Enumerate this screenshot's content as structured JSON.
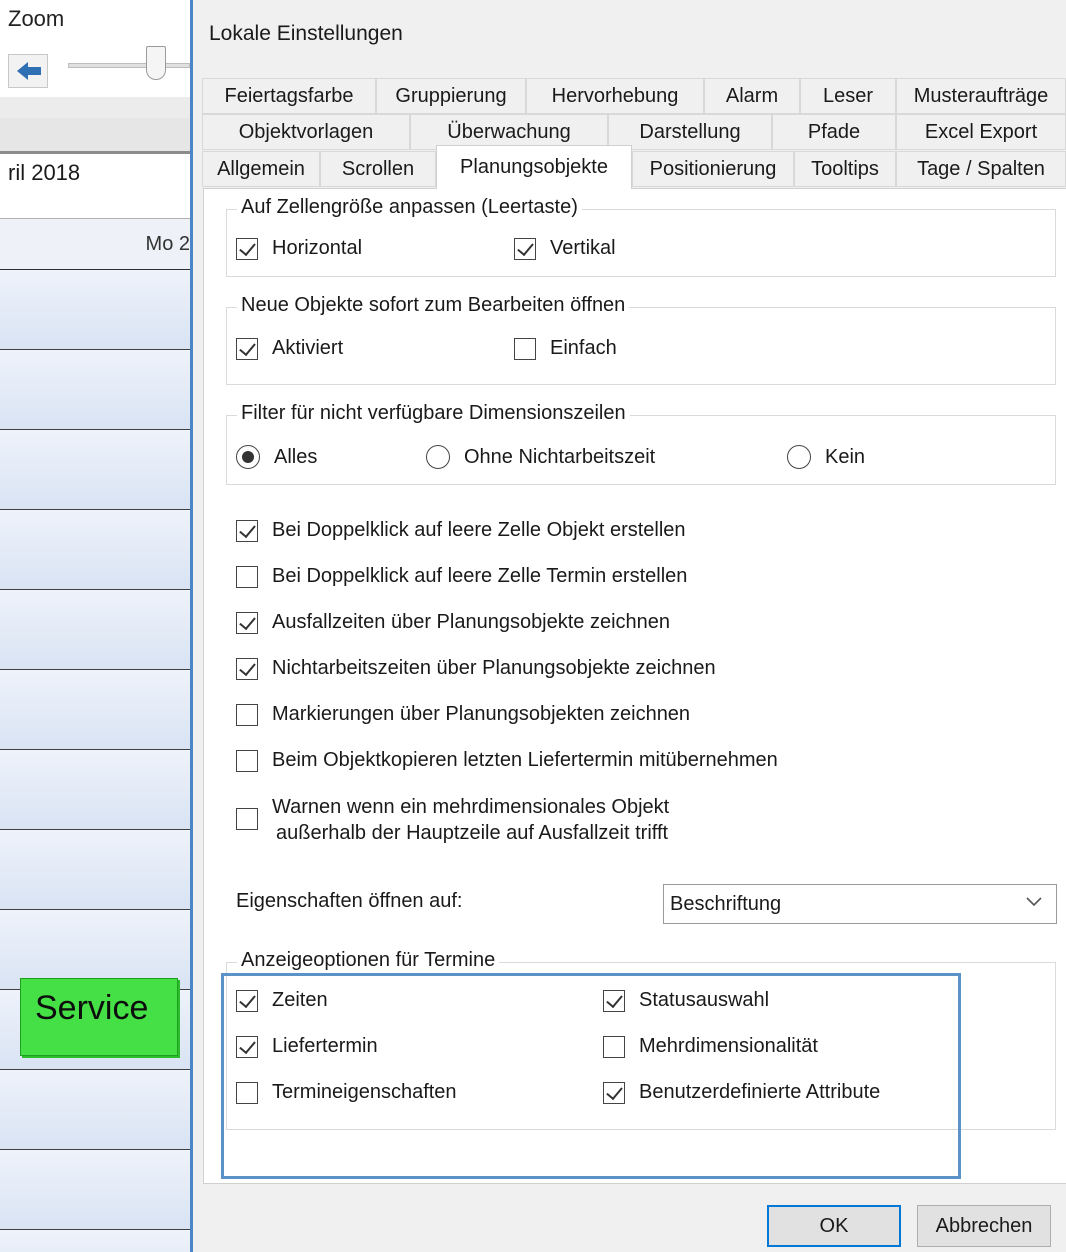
{
  "background_app": {
    "zoom_label": "Zoom",
    "month_label": "ril 2018",
    "day_label": "Mo 2",
    "service_label": "Service",
    "service_color": "#45e045"
  },
  "dialog": {
    "title": "Lokale Einstellungen",
    "tabs_row1": [
      "Feiertagsfarbe",
      "Gruppierung",
      "Hervorhebung",
      "Alarm",
      "Leser",
      "Musteraufträge"
    ],
    "tabs_row2": [
      "Objektvorlagen",
      "Überwachung",
      "Darstellung",
      "Pfade",
      "Excel Export"
    ],
    "tabs_row3": [
      "Allgemein",
      "Scrollen",
      "Planungsobjekte",
      "Positionierung",
      "Tooltips",
      "Tage / Spalten"
    ],
    "active_tab": "Planungsobjekte",
    "group_fit": {
      "title": "Auf Zellengröße anpassen (Leertaste)",
      "horizontal": "Horizontal",
      "vertical": "Vertikal"
    },
    "group_new": {
      "title": "Neue Objekte sofort zum Bearbeiten öffnen",
      "activated": "Aktiviert",
      "simple": "Einfach"
    },
    "group_filter": {
      "title": "Filter für nicht verfügbare Dimensionszeilen",
      "all": "Alles",
      "without_nonwork": "Ohne Nichtarbeitszeit",
      "none": "Kein"
    },
    "options": [
      {
        "label": "Bei Doppelklick auf leere Zelle Objekt erstellen",
        "checked": true
      },
      {
        "label": "Bei Doppelklick auf leere Zelle Termin erstellen",
        "checked": false
      },
      {
        "label": "Ausfallzeiten über Planungsobjekte zeichnen",
        "checked": true
      },
      {
        "label": "Nichtarbeitszeiten über Planungsobjekte zeichnen",
        "checked": true
      },
      {
        "label": "Markierungen über Planungsobjekten zeichnen",
        "checked": false
      },
      {
        "label": "Beim Objektkopieren letzten Liefertermin mitübernehmen",
        "checked": false
      }
    ],
    "warn_line1": "Warnen wenn ein mehrdimensionales Objekt",
    "warn_line2": "außerhalb der Hauptzeile auf Ausfallzeit trifft",
    "props_label": "Eigenschaften öffnen auf:",
    "props_value": "Beschriftung",
    "group_display": {
      "title": "Anzeigeoptionen für Termine",
      "times": "Zeiten",
      "delivery_date": "Liefertermin",
      "appointment_props": "Termineigenschaften",
      "status_selection": "Statusauswahl",
      "multidimensionality": "Mehrdimensionalität",
      "custom_attributes": "Benutzerdefinierte Attribute"
    },
    "ok_label": "OK",
    "cancel_label": "Abbrechen",
    "highlight_color": "#5b93c9"
  }
}
